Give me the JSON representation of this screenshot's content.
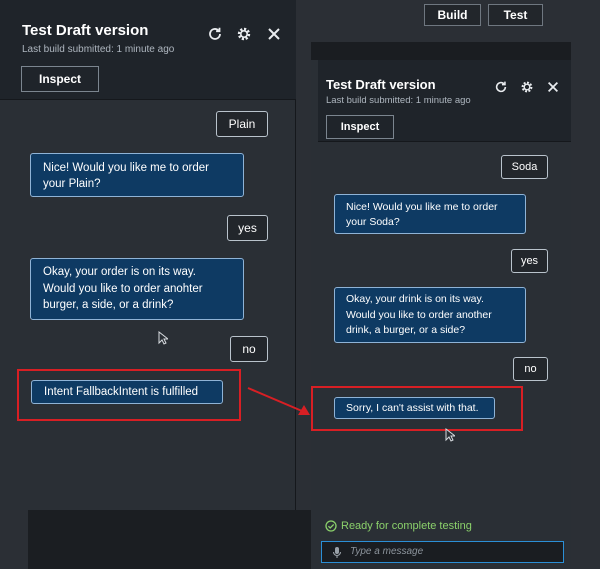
{
  "top_bar": {
    "build_label": "Build",
    "test_label": "Test"
  },
  "left": {
    "title": "Test Draft version",
    "subtitle": "Last build submitted: 1 minute ago",
    "inspect_label": "Inspect",
    "messages": [
      {
        "role": "user",
        "text": "Plain"
      },
      {
        "role": "bot",
        "lines": [
          "Nice! Would you like me to order",
          "your Plain?"
        ]
      },
      {
        "role": "user",
        "text": "yes"
      },
      {
        "role": "bot",
        "lines": [
          "Okay, your order is on its way.",
          "Would you like to order anohter",
          "burger, a side, or a drink?"
        ]
      },
      {
        "role": "user",
        "text": "no"
      },
      {
        "role": "bot",
        "lines": [
          "Intent FallbackIntent is fulfilled"
        ]
      }
    ]
  },
  "right": {
    "title": "Test Draft version",
    "subtitle": "Last build submitted: 1 minute ago",
    "inspect_label": "Inspect",
    "messages": [
      {
        "role": "user",
        "text": "Soda"
      },
      {
        "role": "bot",
        "lines": [
          "Nice! Would you like me to order",
          "your Soda?"
        ]
      },
      {
        "role": "user",
        "text": "yes"
      },
      {
        "role": "bot",
        "lines": [
          "Okay, your drink is on its way.",
          "Would you like to order another",
          "drink, a burger, or a side?"
        ]
      },
      {
        "role": "user",
        "text": "no"
      },
      {
        "role": "bot",
        "lines": [
          "Sorry, I can't assist with that."
        ]
      }
    ],
    "status": "Ready for complete testing",
    "input_placeholder": "Type a message"
  },
  "icons": {
    "refresh": "refresh-icon",
    "settings": "gear-icon",
    "close": "close-icon",
    "mic": "microphone-icon",
    "check": "check-circle-icon"
  },
  "colors": {
    "bot_bubble": "#0e3a63",
    "highlight": "#d81f24",
    "status_ok": "#8bd16b",
    "input_focus": "#2b8fd6"
  }
}
